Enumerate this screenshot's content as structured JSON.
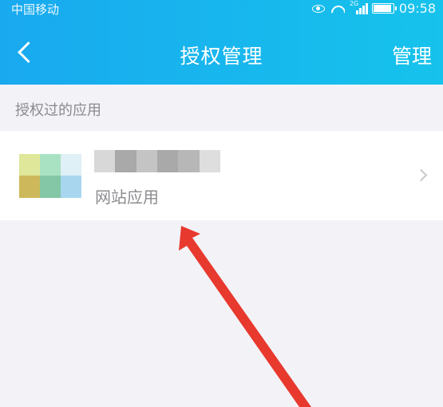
{
  "status_bar": {
    "carrier": "中国移动",
    "network": "2G",
    "time": "09:58"
  },
  "nav": {
    "title": "授权管理",
    "manage_label": "管理"
  },
  "section": {
    "label": "授权过的应用"
  },
  "app": {
    "name": "",
    "type": "网站应用",
    "thumb_colors": [
      "#dfe79a",
      "#a9e2c3",
      "#dff0f6",
      "#cdb95c",
      "#83c7a6",
      "#a8d6ee"
    ],
    "name_blur_colors": [
      "#d8d8d8",
      "#a9a9a9",
      "#c4c4c4",
      "#a9a9a9",
      "#b7b7b7",
      "#dedede"
    ]
  },
  "colors": {
    "header_start": "#19a9ef",
    "header_end": "#16c3ec",
    "arrow": "#e8392f"
  }
}
